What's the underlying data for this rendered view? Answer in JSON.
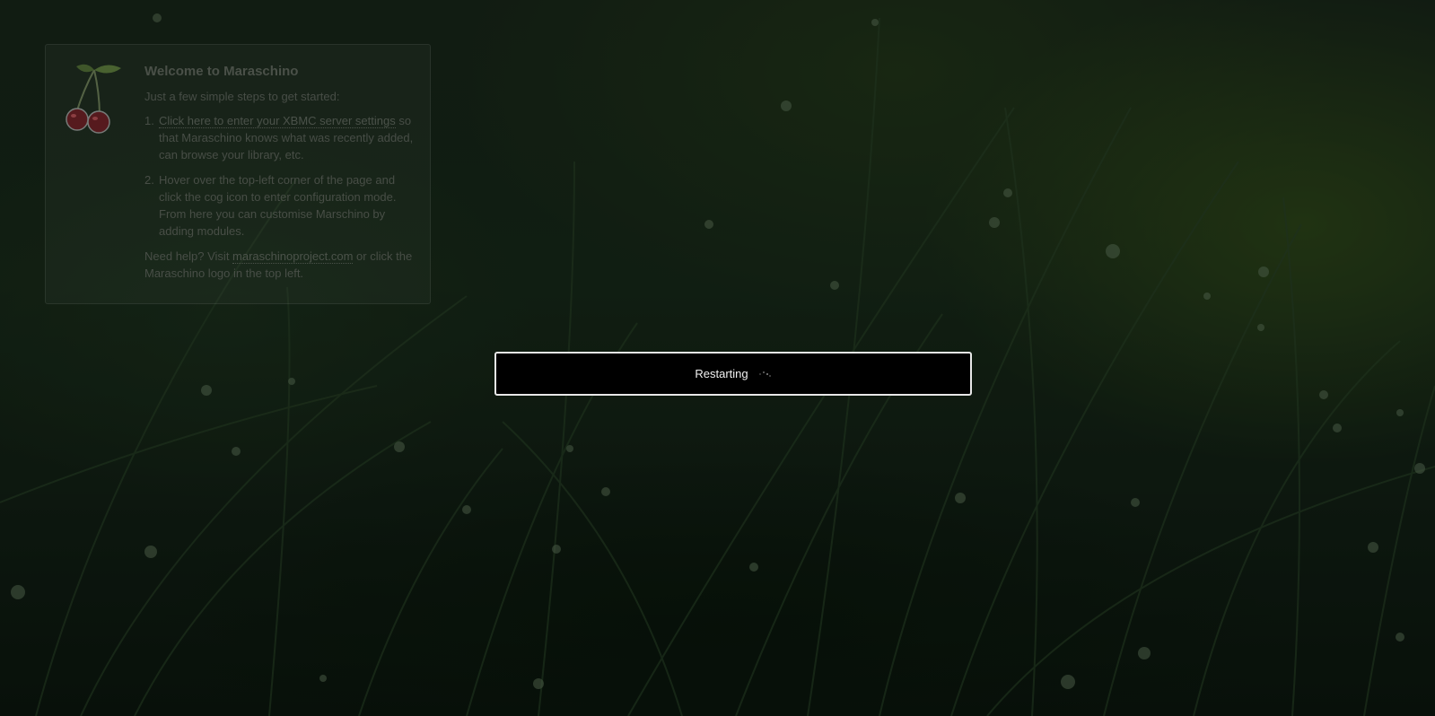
{
  "welcome": {
    "title": "Welcome to Maraschino",
    "intro": "Just a few simple steps to get started:",
    "steps": [
      {
        "number": "1.",
        "link_text": "Click here to enter your XBMC server settings",
        "text": " so that Maraschino knows what was recently added, can browse your library, etc."
      },
      {
        "number": "2.",
        "text": "Hover over the top-left corner of the page and click the cog icon to enter configuration mode. From here you can customise Marschino by adding modules."
      }
    ],
    "help_prefix": "Need help? Visit ",
    "help_link": "maraschinoproject.com",
    "help_suffix": " or click the Maraschino logo in the top left."
  },
  "dialog": {
    "text": "Restarting"
  },
  "icons": {
    "logo": "cherry-icon",
    "spinner": "loading-spinner-icon"
  },
  "colors": {
    "dialog_background": "#000000",
    "dialog_border": "#e8e8e8",
    "cherry": "#6e1a22"
  }
}
